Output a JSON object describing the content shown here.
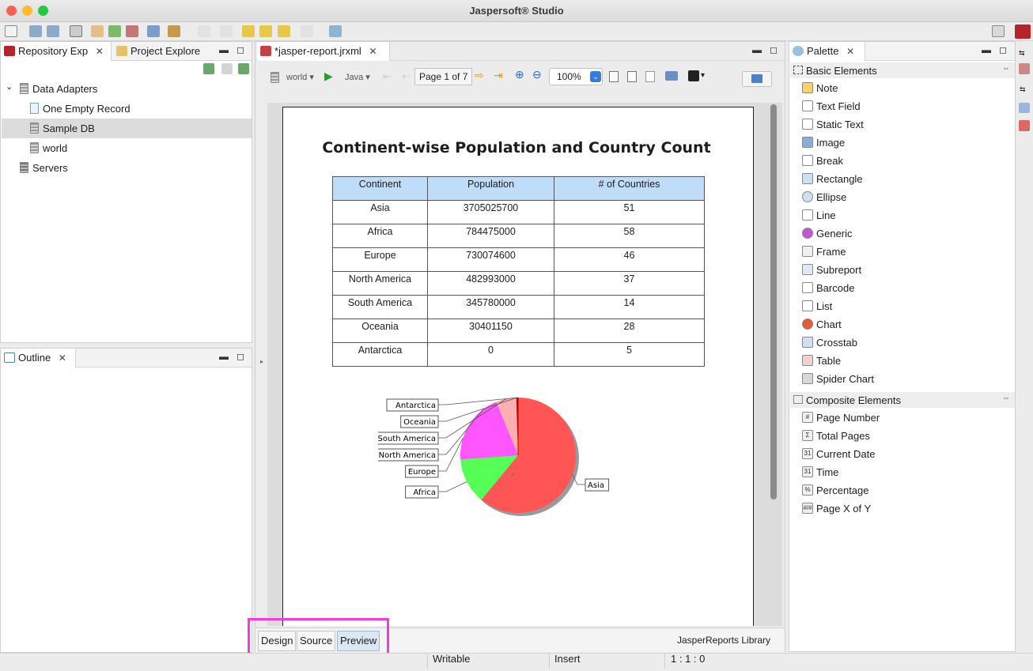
{
  "app": {
    "title": "Jaspersoft® Studio"
  },
  "left_top": {
    "tabs": [
      {
        "label": "Repository Exp"
      },
      {
        "label": "Project Explore"
      }
    ],
    "tree": [
      {
        "label": "Data Adapters"
      },
      {
        "label": "One Empty Record"
      },
      {
        "label": "Sample DB"
      },
      {
        "label": "world"
      },
      {
        "label": "Servers"
      }
    ]
  },
  "outline": {
    "tab_label": "Outline"
  },
  "editor": {
    "tab_label": "*jasper-report.jrxml",
    "toolbar": {
      "adapter": "world",
      "language": "Java",
      "page_indicator": "Page 1 of 7",
      "zoom": "100%"
    },
    "report": {
      "title": "Continent-wise Population and Country Count",
      "columns": [
        "Continent",
        "Population",
        "# of Countries"
      ],
      "rows": [
        [
          "Asia",
          "3705025700",
          "51"
        ],
        [
          "Africa",
          "784475000",
          "58"
        ],
        [
          "Europe",
          "730074600",
          "46"
        ],
        [
          "North America",
          "482993000",
          "37"
        ],
        [
          "South America",
          "345780000",
          "14"
        ],
        [
          "Oceania",
          "30401150",
          "28"
        ],
        [
          "Antarctica",
          "0",
          "5"
        ]
      ]
    },
    "bottom_tabs": [
      "Design",
      "Source",
      "Preview"
    ],
    "library_label": "JasperReports Library"
  },
  "chart_data": {
    "type": "pie",
    "categories": [
      "Asia",
      "Africa",
      "Europe",
      "North America",
      "South America",
      "Oceania",
      "Antarctica"
    ],
    "values": [
      3705025700,
      784475000,
      730074600,
      482993000,
      345780000,
      30401150,
      0
    ],
    "colors": [
      "#ff5555",
      "#55ff55",
      "#ff55ff",
      "#ff55ff",
      "#ffafaf",
      "#c00000",
      "#c00000"
    ]
  },
  "palette": {
    "tab_label": "Palette",
    "basic_header": "Basic Elements",
    "basic": [
      {
        "label": "Note",
        "icon": "note-icon"
      },
      {
        "label": "Text Field",
        "icon": "text-field-icon"
      },
      {
        "label": "Static Text",
        "icon": "static-text-icon"
      },
      {
        "label": "Image",
        "icon": "image-icon"
      },
      {
        "label": "Break",
        "icon": "break-icon"
      },
      {
        "label": "Rectangle",
        "icon": "rectangle-icon"
      },
      {
        "label": "Ellipse",
        "icon": "ellipse-icon"
      },
      {
        "label": "Line",
        "icon": "line-icon"
      },
      {
        "label": "Generic",
        "icon": "generic-icon"
      },
      {
        "label": "Frame",
        "icon": "frame-icon"
      },
      {
        "label": "Subreport",
        "icon": "subreport-icon"
      },
      {
        "label": "Barcode",
        "icon": "barcode-icon"
      },
      {
        "label": "List",
        "icon": "list-icon"
      },
      {
        "label": "Chart",
        "icon": "chart-icon"
      },
      {
        "label": "Crosstab",
        "icon": "crosstab-icon"
      },
      {
        "label": "Table",
        "icon": "table-icon"
      },
      {
        "label": "Spider Chart",
        "icon": "spider-chart-icon"
      }
    ],
    "composite_header": "Composite Elements",
    "composite": [
      {
        "label": "Page Number",
        "icon": "page-number-icon",
        "glyph": "#"
      },
      {
        "label": "Total Pages",
        "icon": "total-pages-icon",
        "glyph": "Σ"
      },
      {
        "label": "Current Date",
        "icon": "current-date-icon",
        "glyph": "31"
      },
      {
        "label": "Time",
        "icon": "time-icon",
        "glyph": "31"
      },
      {
        "label": "Percentage",
        "icon": "percentage-icon",
        "glyph": "%"
      },
      {
        "label": "Page X of Y",
        "icon": "page-x-of-y-icon",
        "glyph": "#/#"
      }
    ]
  },
  "status": {
    "mode": "Writable",
    "insert": "Insert",
    "position": "1 : 1 : 0"
  }
}
